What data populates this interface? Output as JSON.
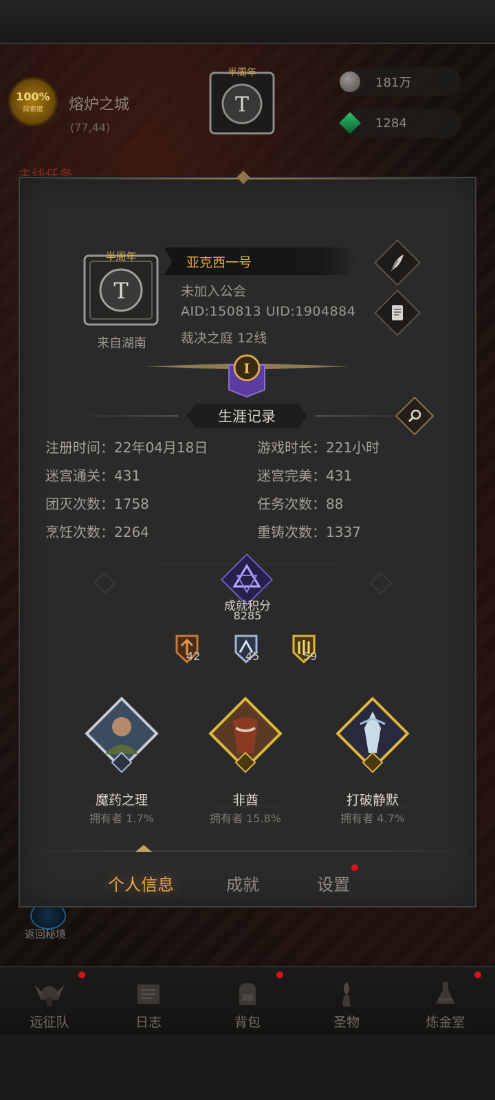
{
  "hud": {
    "explore_percent": "100%",
    "explore_label": "探索度",
    "city_name": "熔炉之城",
    "city_coords": "(77,44)",
    "resources": [
      {
        "icon": "silver-coin-icon",
        "value": "181万"
      },
      {
        "icon": "green-gem-icon",
        "value": "1284"
      }
    ],
    "emblem_text": "半周年",
    "left_tab": "主线任务",
    "return_label": "返回秘境"
  },
  "profile": {
    "avatar_badge": "半周年",
    "origin": "来自湖南",
    "name": "亚克西一号",
    "guild": "未加入公会",
    "ids": "AID:150813 UID:1904884",
    "server": "裁决之庭  12线",
    "rank_numeral": "I"
  },
  "career": {
    "title": "生涯记录",
    "stats": [
      {
        "label": "注册时间",
        "value": "22年04月18日"
      },
      {
        "label": "游戏时长",
        "value": "221小时"
      },
      {
        "label": "迷宫通关",
        "value": "431"
      },
      {
        "label": "迷宫完美",
        "value": "431"
      },
      {
        "label": "团灭次数",
        "value": "1758"
      },
      {
        "label": "任务次数",
        "value": "88"
      },
      {
        "label": "烹饪次数",
        "value": "2264"
      },
      {
        "label": "重铸次数",
        "value": "1337"
      }
    ]
  },
  "achievement": {
    "score_label": "成就积分",
    "score_value": "8285",
    "medals": [
      {
        "tier": "bronze",
        "count": "42",
        "color": "#c47a3a"
      },
      {
        "tier": "silver",
        "count": "45",
        "color": "#9fb6d6"
      },
      {
        "tier": "gold",
        "count": "59",
        "color": "#e0b63a"
      }
    ],
    "showcase": [
      {
        "title": "魔药之理",
        "owners": "拥有者 1.7%",
        "frame": "silver"
      },
      {
        "title": "非酋",
        "owners": "拥有者 15.8%",
        "frame": "gold"
      },
      {
        "title": "打破静默",
        "owners": "拥有者 4.7%",
        "frame": "gold"
      }
    ]
  },
  "tabs": [
    {
      "label": "个人信息",
      "active": true
    },
    {
      "label": "成就",
      "active": false
    },
    {
      "label": "设置",
      "active": false,
      "dot": true
    }
  ],
  "bottom_nav": [
    {
      "label": "远征队",
      "icon": "viking-helmet-icon",
      "dot": true
    },
    {
      "label": "日志",
      "icon": "scroll-icon",
      "dot": false
    },
    {
      "label": "背包",
      "icon": "backpack-icon",
      "dot": true
    },
    {
      "label": "圣物",
      "icon": "relic-icon",
      "dot": false
    },
    {
      "label": "炼金室",
      "icon": "alchemy-icon",
      "dot": true
    }
  ],
  "colors": {
    "accent_gold": "#e3a33e",
    "panel": "#2a2a2a",
    "notification_red": "#d0161a"
  }
}
